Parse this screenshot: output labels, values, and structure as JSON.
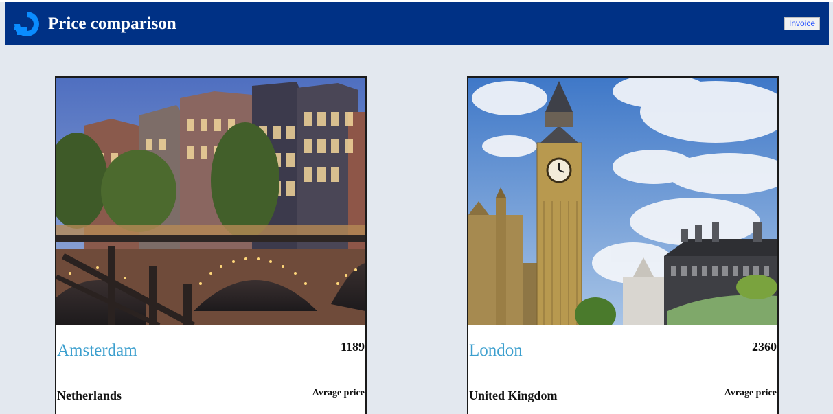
{
  "header": {
    "title": "Price comparison",
    "invoice_label": "Invoice",
    "logo_icon": "droplet-logo-icon",
    "background_color": "#003185"
  },
  "cards": [
    {
      "city": "Amsterdam",
      "country": "Netherlands",
      "price": "1189",
      "price_caption": "Avrage price",
      "image": "amsterdam-canal-bridge-photo"
    },
    {
      "city": "London",
      "country": "United Kingdom",
      "price": "2360",
      "price_caption": "Avrage price",
      "image": "london-big-ben-photo"
    }
  ],
  "colors": {
    "page_background": "#e3e8ef",
    "city_link": "#3c9fce",
    "invoice_text": "#2a55ff"
  }
}
